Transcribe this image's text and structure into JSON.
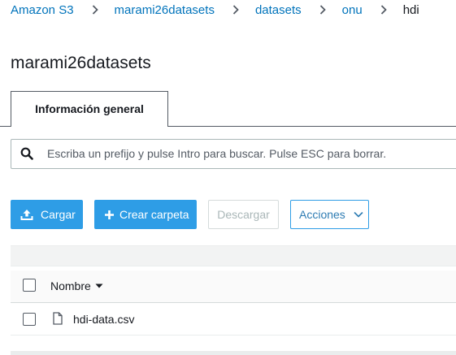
{
  "breadcrumb": {
    "items": [
      "Amazon S3",
      "marami26datasets",
      "datasets",
      "onu"
    ],
    "current": "hdi"
  },
  "page": {
    "title": "marami26datasets"
  },
  "tabs": [
    {
      "label": "Información general",
      "active": true
    }
  ],
  "search": {
    "placeholder": "Escriba un prefijo y pulse Intro para buscar. Pulse ESC para borrar.",
    "value": ""
  },
  "toolbar": {
    "upload_label": "Cargar",
    "create_folder_label": "Crear carpeta",
    "download_label": "Descargar",
    "actions_label": "Acciones"
  },
  "table": {
    "columns": [
      {
        "label": "Nombre",
        "sort": "desc"
      }
    ],
    "rows": [
      {
        "name": "hdi-data.csv",
        "type": "file"
      }
    ]
  },
  "colors": {
    "link": "#0073bb",
    "primary_button": "#2e9de6",
    "text": "#16191f",
    "disabled_text": "#aab7b8"
  }
}
